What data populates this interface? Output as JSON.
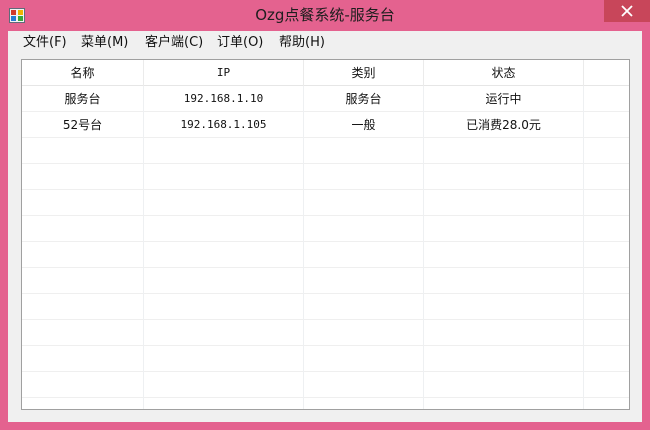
{
  "window": {
    "title": "Ozg点餐系统-服务台",
    "close_icon": "close-icon",
    "app_icon": "app-icon"
  },
  "menu": [
    {
      "label": "文件(F)"
    },
    {
      "label": "菜单(M)"
    },
    {
      "label": "客户端(C)"
    },
    {
      "label": "订单(O)"
    },
    {
      "label": "帮助(H)"
    }
  ],
  "table": {
    "columns": [
      "名称",
      "IP",
      "类别",
      "状态"
    ],
    "rows": [
      {
        "name": "服务台",
        "ip": "192.168.1.10",
        "type": "服务台",
        "status": "运行中"
      },
      {
        "name": "52号台",
        "ip": "192.168.1.105",
        "type": "一般",
        "status": "已消费28.0元"
      }
    ]
  },
  "colors": {
    "frame": "#e4628f",
    "close_button": "#c8465a",
    "client": "#f0f0f0"
  }
}
